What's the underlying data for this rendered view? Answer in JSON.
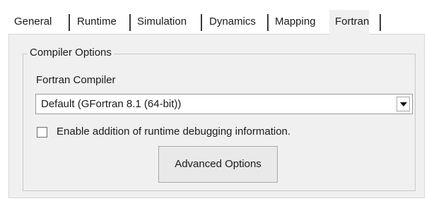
{
  "tabs": [
    {
      "label": "General"
    },
    {
      "label": "Runtime"
    },
    {
      "label": "Simulation"
    },
    {
      "label": "Dynamics"
    },
    {
      "label": "Mapping"
    },
    {
      "label": "Fortran",
      "active": true
    }
  ],
  "compiler_options": {
    "group_title": "Compiler Options",
    "fortran_compiler_label": "Fortran Compiler",
    "fortran_compiler_value": "Default (GFortran 8.1 (64-bit))",
    "debug_checkbox_label": "Enable addition of runtime debugging information.",
    "debug_checkbox_checked": false,
    "advanced_button_label": "Advanced Options"
  },
  "icons": {
    "dropdown": "chevron-down-icon"
  }
}
